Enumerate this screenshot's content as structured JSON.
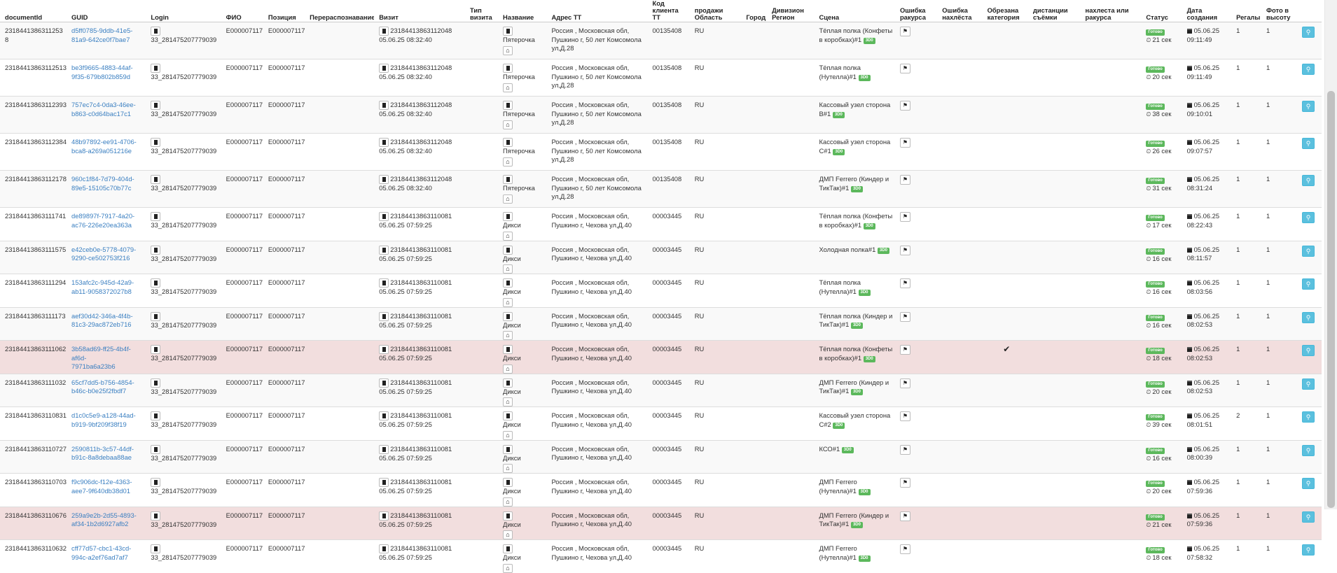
{
  "columns": [
    "documentId",
    "GUID",
    "Login",
    "ФИО",
    "Позиция",
    "Перераспознавание",
    "Визит",
    "Тип визита",
    "Название",
    "Адрес ТТ",
    "Код клиента ТТ",
    "продажи Область",
    "Город",
    "Дивизион Регион",
    "Сцена",
    "Ошибка ракурса",
    "Ошибка нахлёста",
    "Обрезана категория",
    "дистанции съёмки",
    "нахлеста или ракурса",
    "Статус",
    "Дата создания",
    "Регалы",
    "Фото в высоту",
    ""
  ],
  "status_label": "Готово",
  "scene_badge": "3D0",
  "rows": [
    {
      "doc": "2318441386311253​8",
      "guid1": "d5ff0785-9ddb-41e5-",
      "guid2": "81a9-642ce0f7bae7",
      "login": "33_281475207779039",
      "fio": "E000007117",
      "pos": "E000007117",
      "visit_id": "231844138631120​48",
      "visit_dt": "05.06.25 08:32:40",
      "name": "Пятерочка",
      "addr": "Россия , Московская обл, Пушкино г, 50 лет Комсомола ул,Д.28",
      "code": "00135408",
      "region": "RU",
      "scene": "Тёплая полка (Конфеты в коробках)#1",
      "check": "",
      "dur": "21 сек",
      "d1": "05.06.25",
      "d2": "09:11:49",
      "reg": "1",
      "photo": "1"
    },
    {
      "doc": "23184413863112513",
      "guid1": "be3f9665-4883-44af-",
      "guid2": "9f35-679b802b859d",
      "login": "33_281475207779039",
      "fio": "E000007117",
      "pos": "E000007117",
      "visit_id": "23184413863112048",
      "visit_dt": "05.06.25 08:32:40",
      "name": "Пятерочка",
      "addr": "Россия , Московская обл, Пушкино г, 50 лет Комсомола ул,Д.28",
      "code": "00135408",
      "region": "RU",
      "scene": "Тёплая полка (Нутелла)#1",
      "check": "",
      "dur": "20 сек",
      "d1": "05.06.25",
      "d2": "09:11:49",
      "reg": "1",
      "photo": "1"
    },
    {
      "doc": "23184413863112393",
      "guid1": "757ec7c4-0da3-46ee-",
      "guid2": "b863-c0d64bac17c1",
      "login": "33_281475207779039",
      "fio": "E000007117",
      "pos": "E000007117",
      "visit_id": "23184413863112048",
      "visit_dt": "05.06.25 08:32:40",
      "name": "Пятерочка",
      "addr": "Россия , Московская обл, Пушкино г, 50 лет Комсомола ул,Д.28",
      "code": "00135408",
      "region": "RU",
      "scene": "Кассовый узел сторона В#1",
      "check": "",
      "dur": "38 сек",
      "d1": "05.06.25",
      "d2": "09:10:01",
      "reg": "1",
      "photo": "1"
    },
    {
      "doc": "23184413863112384",
      "guid1": "48b97892-ee91-4706-",
      "guid2": "bca8-a269a051216e",
      "login": "33_281475207779039",
      "fio": "E000007117",
      "pos": "E000007117",
      "visit_id": "23184413863112048",
      "visit_dt": "05.06.25 08:32:40",
      "name": "Пятерочка",
      "addr": "Россия , Московская обл, Пушкино г, 50 лет Комсомола ул,Д.28",
      "code": "00135408",
      "region": "RU",
      "scene": "Кассовый узел сторона С#1",
      "check": "",
      "dur": "26 сек",
      "d1": "05.06.25",
      "d2": "09:07:57",
      "reg": "1",
      "photo": "1"
    },
    {
      "doc": "23184413863112178",
      "guid1": "960c1f84-7d79-404d-",
      "guid2": "89e5-15105c70b77c",
      "login": "33_281475207779039",
      "fio": "E000007117",
      "pos": "E000007117",
      "visit_id": "23184413863112048",
      "visit_dt": "05.06.25 08:32:40",
      "name": "Пятерочка",
      "addr": "Россия , Московская обл, Пушкино г, 50 лет Комсомола ул,Д.28",
      "code": "00135408",
      "region": "RU",
      "scene": "ДМП Ferrero (Киндер и ТикТак)#1",
      "check": "",
      "dur": "31 сек",
      "d1": "05.06.25",
      "d2": "08:31:24",
      "reg": "1",
      "photo": "1"
    },
    {
      "doc": "23184413863111741",
      "guid1": "de89897f-7917-4a20-",
      "guid2": "ac76-226e20ea363a",
      "login": "33_281475207779039",
      "fio": "E000007117",
      "pos": "E000007117",
      "visit_id": "23184413863110081",
      "visit_dt": "05.06.25 07:59:25",
      "name": "Дикси",
      "addr": "Россия , Московская обл, Пушкино г, Чехова ул,Д.40",
      "code": "00003445",
      "region": "RU",
      "scene": "Тёплая полка (Конфеты в коробках)#1",
      "check": "",
      "dur": "17 сек",
      "d1": "05.06.25",
      "d2": "08:22:43",
      "reg": "1",
      "photo": "1"
    },
    {
      "doc": "23184413863111575",
      "guid1": "e42ceb0e-5778-4079-",
      "guid2": "9290-ce502753f216",
      "login": "33_281475207779039",
      "fio": "E000007117",
      "pos": "E000007117",
      "visit_id": "23184413863110081",
      "visit_dt": "05.06.25 07:59:25",
      "name": "Дикси",
      "addr": "Россия , Московская обл, Пушкино г, Чехова ул,Д.40",
      "code": "00003445",
      "region": "RU",
      "scene": "Холодная полка#1",
      "check": "",
      "dur": "16 сек",
      "d1": "05.06.25",
      "d2": "08:11:57",
      "reg": "1",
      "photo": "1"
    },
    {
      "doc": "23184413863111294",
      "guid1": "153afc2c-945d-42a9-",
      "guid2": "ab11-9058372027b8",
      "login": "33_281475207779039",
      "fio": "E000007117",
      "pos": "E000007117",
      "visit_id": "23184413863110081",
      "visit_dt": "05.06.25 07:59:25",
      "name": "Дикси",
      "addr": "Россия , Московская обл, Пушкино г, Чехова ул,Д.40",
      "code": "00003445",
      "region": "RU",
      "scene": "Тёплая полка (Нутелла)#1",
      "check": "",
      "dur": "16 сек",
      "d1": "05.06.25",
      "d2": "08:03:56",
      "reg": "1",
      "photo": "1"
    },
    {
      "doc": "23184413863111173",
      "guid1": "aef30d42-346a-4f4b-",
      "guid2": "81c3-29ac872eb716",
      "login": "33_281475207779039",
      "fio": "E000007117",
      "pos": "E000007117",
      "visit_id": "23184413863110081",
      "visit_dt": "05.06.25 07:59:25",
      "name": "Дикси",
      "addr": "Россия , Московская обл, Пушкино г, Чехова ул,Д.40",
      "code": "00003445",
      "region": "RU",
      "scene": "Тёплая полка (Киндер и ТикТак)#1",
      "check": "",
      "dur": "16 сек",
      "d1": "05.06.25",
      "d2": "08:02:53",
      "reg": "1",
      "photo": "1"
    },
    {
      "doc": "23184413863111062",
      "guid1": "3b58ad69-ff25-4b4f-af6d-",
      "guid2": "7971ba6a23b6",
      "login": "33_281475207779039",
      "fio": "E000007117",
      "pos": "E000007117",
      "visit_id": "23184413863110081",
      "visit_dt": "05.06.25 07:59:25",
      "name": "Дикси",
      "addr": "Россия , Московская обл, Пушкино г, Чехова ул,Д.40",
      "code": "00003445",
      "region": "RU",
      "scene": "Тёплая полка (Конфеты в коробках)#1",
      "check": "✔",
      "dur": "18 сек",
      "d1": "05.06.25",
      "d2": "08:02:53",
      "reg": "1",
      "photo": "1"
    },
    {
      "doc": "23184413863111032",
      "guid1": "65cf7dd5-b756-4854-",
      "guid2": "b46c-b0e25f2fbdf7",
      "login": "33_281475207779039",
      "fio": "E000007117",
      "pos": "E000007117",
      "visit_id": "23184413863110081",
      "visit_dt": "05.06.25 07:59:25",
      "name": "Дикси",
      "addr": "Россия , Московская обл, Пушкино г, Чехова ул,Д.40",
      "code": "00003445",
      "region": "RU",
      "scene": "ДМП Ferrero (Киндер и ТикТак)#1",
      "check": "",
      "dur": "20 сек",
      "d1": "05.06.25",
      "d2": "08:02:53",
      "reg": "1",
      "photo": "1"
    },
    {
      "doc": "23184413863110831",
      "guid1": "d1c0c5e9-a128-44ad-",
      "guid2": "b919-9bf209f38f19",
      "login": "33_281475207779039",
      "fio": "E000007117",
      "pos": "E000007117",
      "visit_id": "23184413863110081",
      "visit_dt": "05.06.25 07:59:25",
      "name": "Дикси",
      "addr": "Россия , Московская обл, Пушкино г, Чехова ул,Д.40",
      "code": "00003445",
      "region": "RU",
      "scene": "Кассовый узел сторона С#2",
      "check": "",
      "dur": "39 сек",
      "d1": "05.06.25",
      "d2": "08:01:51",
      "reg": "2",
      "photo": "1"
    },
    {
      "doc": "23184413863110727",
      "guid1": "2590811b-3c57-44df-",
      "guid2": "b91c-8a8debaa88ae",
      "login": "33_281475207779039",
      "fio": "E000007117",
      "pos": "E000007117",
      "visit_id": "23184413863110081",
      "visit_dt": "05.06.25 07:59:25",
      "name": "Дикси",
      "addr": "Россия , Московская обл, Пушкино г, Чехова ул,Д.40",
      "code": "00003445",
      "region": "RU",
      "scene": "КСО#1",
      "check": "",
      "dur": "16 сек",
      "d1": "05.06.25",
      "d2": "08:00:39",
      "reg": "1",
      "photo": "1"
    },
    {
      "doc": "23184413863110703",
      "guid1": "f9c906dc-f12e-4363-",
      "guid2": "aee7-9f640db38d01",
      "login": "33_281475207779039",
      "fio": "E000007117",
      "pos": "E000007117",
      "visit_id": "23184413863110081",
      "visit_dt": "05.06.25 07:59:25",
      "name": "Дикси",
      "addr": "Россия , Московская обл, Пушкино г, Чехова ул,Д.40",
      "code": "00003445",
      "region": "RU",
      "scene": "ДМП Ferrero (Нутелла)#1",
      "check": "",
      "dur": "20 сек",
      "d1": "05.06.25",
      "d2": "07:59:36",
      "reg": "1",
      "photo": "1"
    },
    {
      "doc": "23184413863110676",
      "guid1": "259a9e2b-2d55-4893-",
      "guid2": "af34-1b2d6927afb2",
      "login": "33_281475207779039",
      "fio": "E000007117",
      "pos": "E000007117",
      "visit_id": "23184413863110081",
      "visit_dt": "05.06.25 07:59:25",
      "name": "Дикси",
      "addr": "Россия , Московская обл, Пушкино г, Чехова ул,Д.40",
      "code": "00003445",
      "region": "RU",
      "scene": "ДМП Ferrero (Киндер и ТикТак)#1",
      "check": "",
      "dur": "21 сек",
      "d1": "05.06.25",
      "d2": "07:59:36",
      "reg": "1",
      "photo": "1"
    },
    {
      "doc": "23184413863110632",
      "guid1": "cff77d57-cbc1-43cd-",
      "guid2": "994c-a2ef76ad7af7",
      "login": "33_281475207779039",
      "fio": "E000007117",
      "pos": "E000007117",
      "visit_id": "23184413863110081",
      "visit_dt": "05.06.25 07:59:25",
      "name": "Дикси",
      "addr": "Россия , Московская обл, Пушкино г, Чехова ул,Д.40",
      "code": "00003445",
      "region": "RU",
      "scene": "ДМП Ferrero (Нутелла)#1",
      "check": "",
      "dur": "18 сек",
      "d1": "05.06.25",
      "d2": "07:58:32",
      "reg": "1",
      "photo": "1"
    }
  ]
}
